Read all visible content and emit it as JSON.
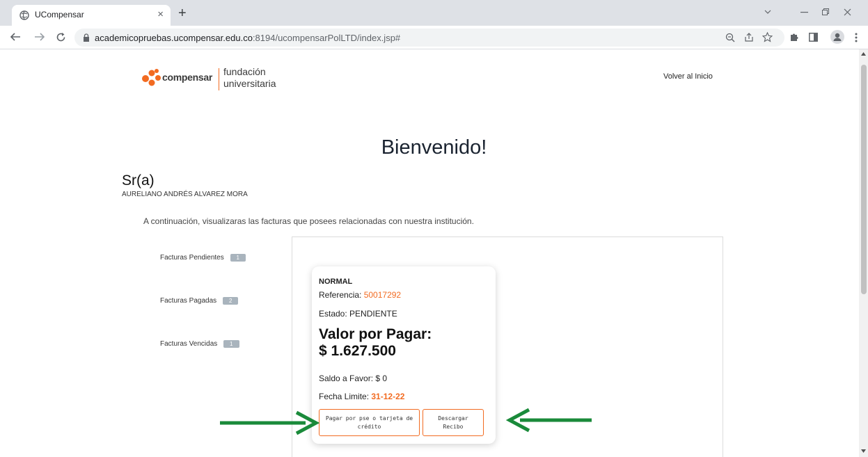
{
  "browser": {
    "tab_title": "UCompensar",
    "tab_close": "×",
    "new_tab": "+",
    "url_host": "academicopruebas.ucompensar.edu.co",
    "url_path": ":8194/ucompensarPolLTD/index.jsp#"
  },
  "header": {
    "logo_brand": "compensar",
    "logo_sub1": "fundación",
    "logo_sub2": "universitaria",
    "home_link": "Volver al Inicio"
  },
  "main": {
    "welcome": "Bienvenido!",
    "salutation": "Sr(a)",
    "user_name": "AURELIANO ANDRÉS ALVAREZ MORA",
    "intro": "A continuación, visualizaras las facturas que posees relacionadas con nuestra institución."
  },
  "sidebar": {
    "items": [
      {
        "label": "Facturas Pendientes",
        "count": "1"
      },
      {
        "label": "Facturas Pagadas",
        "count": "2"
      },
      {
        "label": "Facturas Vencidas",
        "count": "1"
      }
    ]
  },
  "invoice": {
    "type": "NORMAL",
    "ref_label": "Referencia: ",
    "ref_value": "50017292",
    "state": "Estado: PENDIENTE",
    "value_label": "Valor por Pagar:",
    "value": "$ 1.627.500",
    "saldo": "Saldo a Favor: $ 0",
    "fecha_label": "Fecha Limite: ",
    "fecha_value": "31-12-22",
    "pay_button_line1": "Pagar por pse o tarjeta de",
    "pay_button_line2": "crédito",
    "download_button_line1": "Descargar",
    "download_button_line2": "Recibo"
  },
  "colors": {
    "accent": "#f26b21",
    "arrow": "#1a8a3a"
  }
}
